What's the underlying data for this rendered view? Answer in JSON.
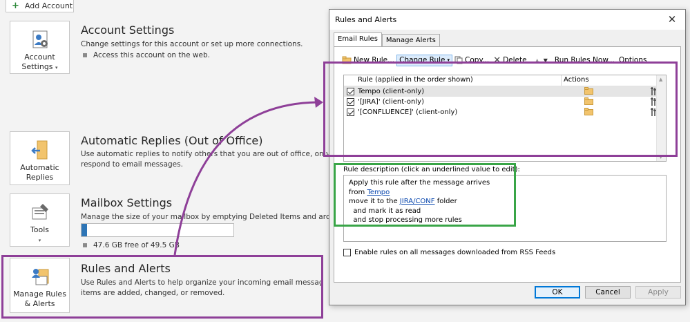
{
  "backstage": {
    "add_account_label": "Add Account",
    "account_settings": {
      "tile_label_line1": "Account",
      "tile_label_line2": "Settings",
      "title": "Account Settings",
      "description": "Change settings for this account or set up more connections.",
      "bullet": "Access this account on the web."
    },
    "automatic_replies": {
      "tile_label_line1": "Automatic",
      "tile_label_line2": "Replies",
      "title": "Automatic Replies (Out of Office)",
      "description_line1": "Use automatic replies to notify others that you are out of office, on vacatio",
      "description_line2": "respond to email messages."
    },
    "mailbox_settings": {
      "tile_label": "Tools",
      "title": "Mailbox Settings",
      "description": "Manage the size of your mailbox by emptying Deleted Items and archiving.",
      "storage_text": "47.6 GB free of 49.5 GB",
      "storage_used_fraction": 0.038
    },
    "rules_and_alerts": {
      "tile_label_line1": "Manage Rules",
      "tile_label_line2": "& Alerts",
      "title": "Rules and Alerts",
      "description_line1": "Use Rules and Alerts to help organize your incoming email messages, and e",
      "description_line2": "items are added, changed, or removed."
    }
  },
  "dialog": {
    "title": "Rules and Alerts",
    "tabs": [
      {
        "label": "Email Rules",
        "active": true
      },
      {
        "label": "Manage Alerts",
        "active": false
      }
    ],
    "toolbar": {
      "new_rule": "New Rule...",
      "change_rule": "Change Rule",
      "copy": "Copy...",
      "delete": "Delete",
      "run_rules_now": "Run Rules Now...",
      "options": "Options"
    },
    "list": {
      "col_rule": "Rule (applied in the order shown)",
      "col_actions": "Actions",
      "rows": [
        {
          "name": "Tempo  (client-only)",
          "checked": true,
          "selected": true
        },
        {
          "name": "'[JIRA]'  (client-only)",
          "checked": true,
          "selected": false
        },
        {
          "name": "'[CONFLUENCE]'  (client-only)",
          "checked": true,
          "selected": false
        }
      ]
    },
    "description_label": "Rule description (click an underlined value to edit):",
    "description": {
      "line1": "Apply this rule after the message arrives",
      "line2_prefix": "from ",
      "line2_link": "Tempo",
      "line3_prefix": "move it to the ",
      "line3_link": "JIRA/CONF",
      "line3_suffix": " folder",
      "line4": "  and mark it as read",
      "line5": "  and stop processing more rules"
    },
    "rss_label": "Enable rules on all messages downloaded from RSS Feeds",
    "buttons": {
      "ok": "OK",
      "cancel": "Cancel",
      "apply": "Apply"
    }
  },
  "colors": {
    "highlight_purple": "#8e3f98",
    "highlight_green": "#39a547",
    "progress_fill": "#2e75b6"
  }
}
